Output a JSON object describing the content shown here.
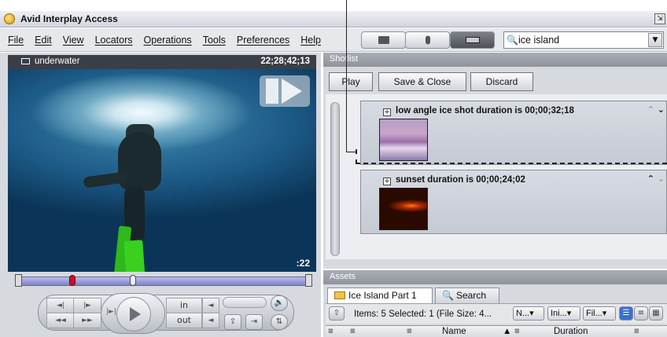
{
  "window": {
    "title": "Avid Interplay Access"
  },
  "menu": [
    "File",
    "Edit",
    "View",
    "Locators",
    "Operations",
    "Tools",
    "Preferences",
    "Help"
  ],
  "search": {
    "value": "ice island"
  },
  "player": {
    "clip_name": "underwater",
    "timecode": "22;28;42;13",
    "counter": ":22",
    "controls": {
      "in_label": "in",
      "out_label": "out"
    }
  },
  "shotlist": {
    "header": "Shotlist",
    "buttons": {
      "play": "Play",
      "save_close": "Save & Close",
      "discard": "Discard"
    },
    "shots": [
      {
        "title": "low angle ice shot duration is 00;00;32;18"
      },
      {
        "title": "sunset duration is 00;00;24;02"
      }
    ]
  },
  "assets": {
    "header": "Assets",
    "tabs": [
      {
        "label": "Ice Island Part 1"
      },
      {
        "label": "Search"
      }
    ],
    "status": "Items: 5 Selected: 1 (File Size: 4...",
    "filters": [
      "N...",
      "Ini...",
      "Fil..."
    ],
    "columns": [
      "Name",
      "Duration"
    ]
  },
  "colors": {
    "accent_green": "#39d01f",
    "header_gray": "#9a9ea6",
    "marker_red": "#c8102e"
  }
}
